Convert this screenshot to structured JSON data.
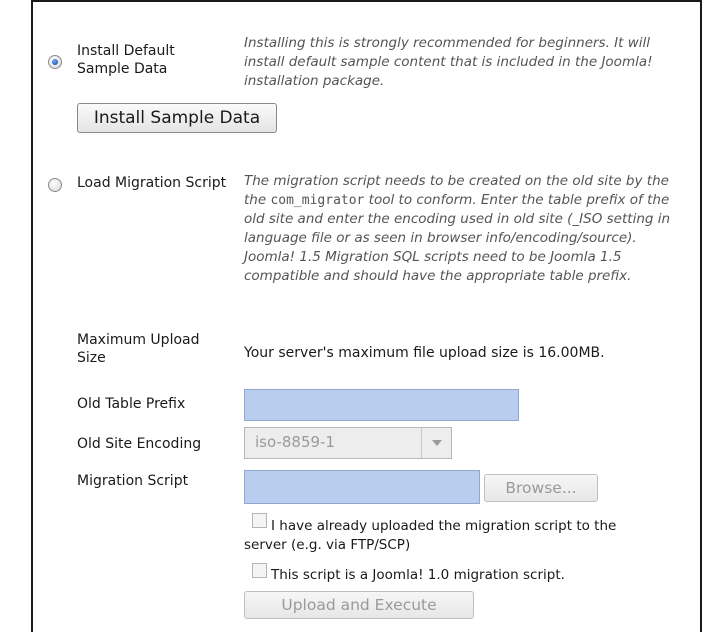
{
  "sample_data": {
    "radio_label_line1": "Install Default",
    "radio_label_line2": "Sample Data",
    "selected": true,
    "description": "Installing this is strongly recommended for beginners. It will install default sample content that is included in the Joomla! installation package.",
    "button_label": "Install Sample Data"
  },
  "migration": {
    "radio_label": "Load Migration Script",
    "selected": false,
    "description_part1": "The migration script needs to be created on the old site by the",
    "description_code": "com_migrator",
    "description_part2": "tool to conform. Enter the table prefix of the old site and enter the encoding used in old site (_ISO setting in language file or as seen in browser info/encoding/source).",
    "description_note": "Joomla! 1.5 Migration SQL scripts need to be Joomla 1.5 compatible and should have the appropriate table prefix."
  },
  "form": {
    "max_upload_label_line1": "Maximum Upload",
    "max_upload_label_line2": "Size",
    "max_upload_value": "Your server's maximum file upload size is 16.00MB.",
    "old_prefix_label": "Old Table Prefix",
    "old_prefix_value": "",
    "encoding_label": "Old Site Encoding",
    "encoding_value": "iso-8859-1",
    "migration_script_label": "Migration Script",
    "browse_label": "Browse...",
    "already_uploaded_line1": "I have already uploaded the migration script to the",
    "already_uploaded_line2": "server (e.g. via FTP/SCP)",
    "joomla10_label": "This script is a Joomla! 1.0 migration script.",
    "upload_button": "Upload and Execute"
  },
  "colors": {
    "input_fill": "#b9cdee",
    "radio_selected": "#2a5fb8",
    "description_text": "#555555"
  }
}
